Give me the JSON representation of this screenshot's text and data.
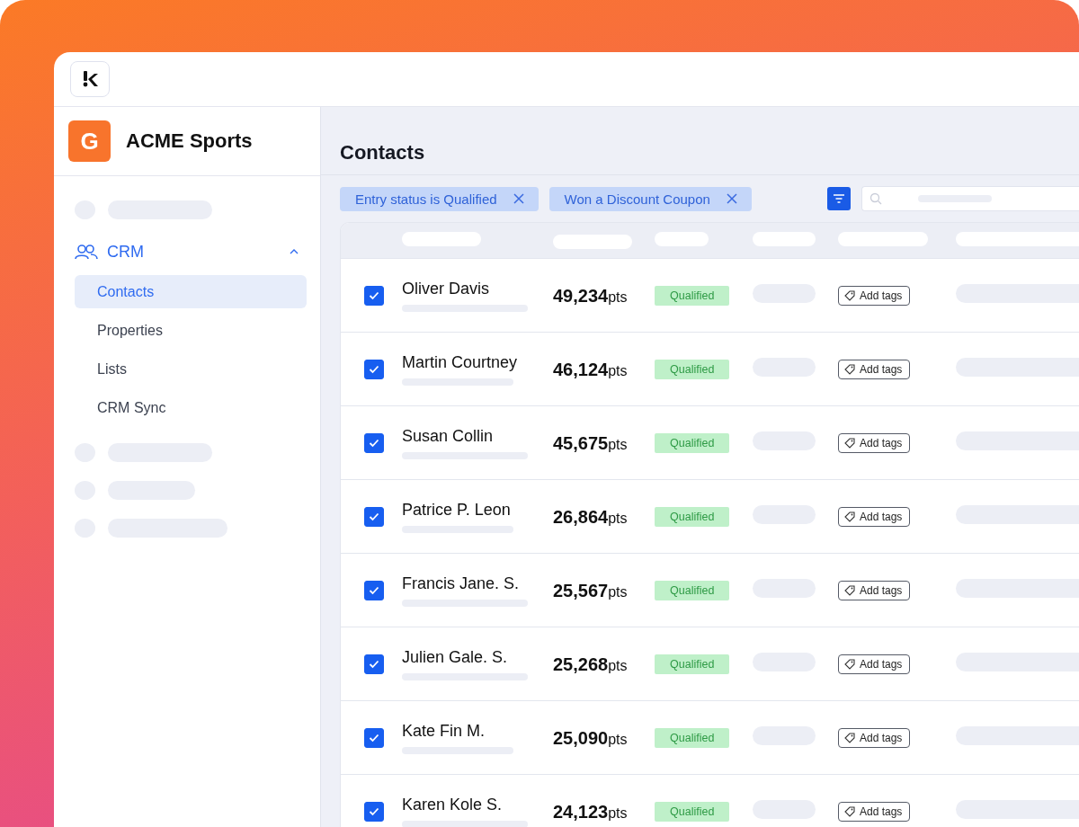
{
  "brand": {
    "initial": "G",
    "name": "ACME Sports"
  },
  "sidebar": {
    "section": {
      "label": "CRM",
      "expanded": true
    },
    "items": [
      {
        "label": "Contacts",
        "selected": true
      },
      {
        "label": "Properties",
        "selected": false
      },
      {
        "label": "Lists",
        "selected": false
      },
      {
        "label": "CRM Sync",
        "selected": false
      }
    ]
  },
  "page_title": "Contacts",
  "filters": [
    {
      "label": "Entry status is Qualified"
    },
    {
      "label": "Won a Discount Coupon"
    }
  ],
  "rows": [
    {
      "checked": true,
      "name": "Oliver Davis",
      "points": "49,234",
      "unit": "pts",
      "status": "Qualified",
      "tags": "Add tags"
    },
    {
      "checked": true,
      "name": "Martin Courtney",
      "points": "46,124",
      "unit": "pts",
      "status": "Qualified",
      "tags": "Add tags"
    },
    {
      "checked": true,
      "name": "Susan Collin",
      "points": "45,675",
      "unit": "pts",
      "status": "Qualified",
      "tags": "Add tags"
    },
    {
      "checked": true,
      "name": "Patrice P. Leon",
      "points": "26,864",
      "unit": "pts",
      "status": "Qualified",
      "tags": "Add tags"
    },
    {
      "checked": true,
      "name": "Francis Jane. S.",
      "points": "25,567",
      "unit": "pts",
      "status": "Qualified",
      "tags": "Add tags"
    },
    {
      "checked": true,
      "name": "Julien Gale. S.",
      "points": "25,268",
      "unit": "pts",
      "status": "Qualified",
      "tags": "Add tags"
    },
    {
      "checked": true,
      "name": "Kate Fin M.",
      "points": "25,090",
      "unit": "pts",
      "status": "Qualified",
      "tags": "Add tags"
    },
    {
      "checked": true,
      "name": "Karen Kole S.",
      "points": "24,123",
      "unit": "pts",
      "status": "Qualified",
      "tags": "Add tags"
    }
  ]
}
